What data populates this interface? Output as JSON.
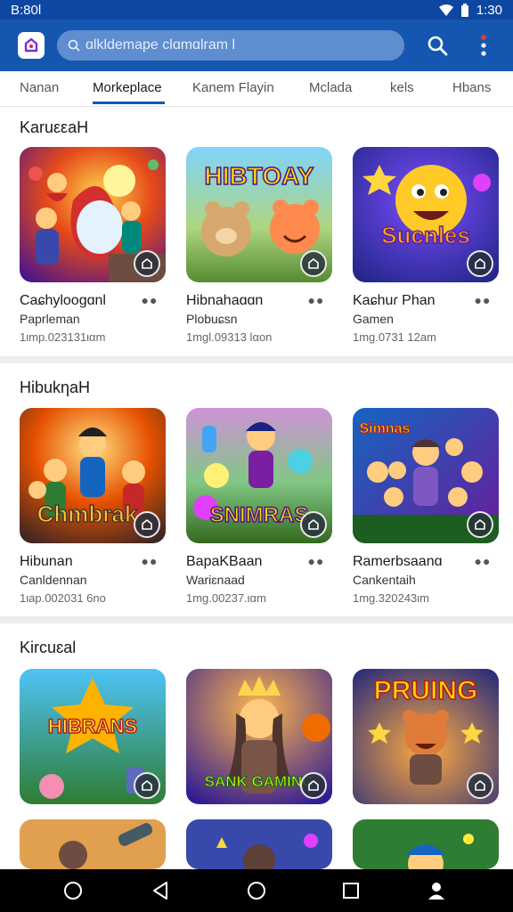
{
  "status_bar": {
    "time": "B:80l",
    "clock": "1:30"
  },
  "search": {
    "placeholder": "ɑlkldemape clɑmɑlram l"
  },
  "tabs": [
    {
      "label": "Nanan",
      "active": false
    },
    {
      "label": "Morkeplace",
      "active": true
    },
    {
      "label": "Kanem Flayin",
      "active": false
    },
    {
      "label": "Mclada",
      "active": false
    },
    {
      "label": "kels",
      "active": false
    },
    {
      "label": "Hbans",
      "active": false
    }
  ],
  "sections": [
    {
      "title": "KaruεεaH",
      "cards": [
        {
          "title": "Caɕhyloogɑnl",
          "subtitle": "Paprleman",
          "meta": "1ιmp.023131ιαm",
          "art_text": "",
          "icon": "install-icon"
        },
        {
          "title": "Hibnahaɑɑn",
          "subtitle": "Plobuɕsn",
          "meta": "1mgl.09313 lαon",
          "art_text": "HIBTOAY",
          "icon": "install-icon"
        },
        {
          "title": "Kaɕhuɾ Phan",
          "subtitle": "Gamen",
          "meta": "1mg.0731 12am",
          "art_text": "Sucnles",
          "icon": "install-icon"
        }
      ]
    },
    {
      "title": "HibukηaH",
      "cards": [
        {
          "title": "Hibunan",
          "subtitle": "Canldennan",
          "meta": "1ιap.002031 6no",
          "art_text": "Chmbrak",
          "icon": "install-icon"
        },
        {
          "title": "BapaKBaan",
          "subtitle": "Wariɛnaad",
          "meta": "1mg.00237.ιαm",
          "art_text": "SNIMRAS",
          "icon": "install-icon"
        },
        {
          "title": "Ramerbsaanɑ",
          "subtitle": "Cankentaih",
          "meta": "1mg.320243ιm",
          "art_text": "Simnas",
          "icon": "install-icon"
        }
      ]
    },
    {
      "title": "Kircuɛal",
      "cards": [
        {
          "title": "",
          "subtitle": "",
          "meta": "",
          "art_text": "HIBRANS",
          "icon": "install-icon"
        },
        {
          "title": "",
          "subtitle": "",
          "meta": "",
          "art_text": "SANK GAMING",
          "icon": "install-icon"
        },
        {
          "title": "",
          "subtitle": "",
          "meta": "",
          "art_text": "PRUING",
          "icon": "install-icon"
        }
      ]
    }
  ],
  "colors": {
    "primary": "#1557b0",
    "status": "#0d47a1",
    "divider": "#ededed"
  },
  "icons": [
    "app-logo-icon",
    "search-icon",
    "more-vert-icon",
    "install-icon",
    "nav-circle-icon",
    "nav-back-icon",
    "nav-home-icon",
    "nav-recents-icon",
    "nav-profile-icon"
  ]
}
